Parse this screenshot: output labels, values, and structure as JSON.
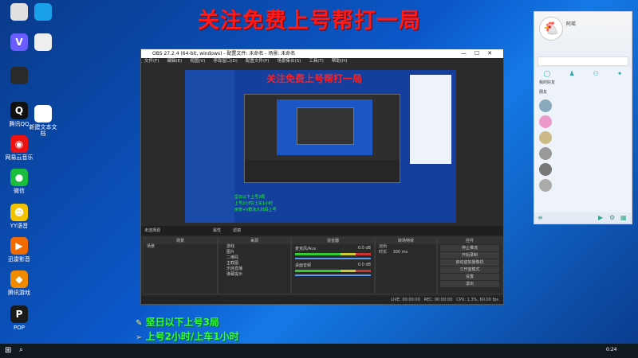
{
  "banner": "关注免费上号帮打一局",
  "desktop_icons": [
    {
      "label": "",
      "glyph": "",
      "color": "#e0e0e0"
    },
    {
      "label": "",
      "glyph": "",
      "color": "#1aa0e8"
    },
    {
      "label": "",
      "glyph": "V",
      "color": "#6a5cff"
    },
    {
      "label": "",
      "glyph": "",
      "color": "#eeeeee"
    },
    {
      "label": "",
      "glyph": "",
      "color": "#2a2a2a"
    },
    {
      "label": "腾讯QQ",
      "glyph": "Q",
      "color": "#111111"
    },
    {
      "label": "新建文本文档",
      "glyph": "",
      "color": "#ffffff"
    },
    {
      "label": "网易云音乐",
      "glyph": "◉",
      "color": "#e11"
    },
    {
      "label": "微信",
      "glyph": "●",
      "color": "#1bbe3a"
    },
    {
      "label": "YY语音",
      "glyph": "☻",
      "color": "#f2c200"
    },
    {
      "label": "迅雷影音",
      "glyph": "▶",
      "color": "#f06a00"
    },
    {
      "label": "腾讯游戏",
      "glyph": "◆",
      "color": "#f08a00"
    },
    {
      "label": "POP",
      "glyph": "P",
      "color": "#1a1a1a"
    }
  ],
  "obs": {
    "title": "OBS 27.2.4 (64-bit, windows) - 配置文件: 未命名 - 场景: 未命名",
    "menu": [
      "文件(F)",
      "编辑(E)",
      "视图(V)",
      "停靠窗口(D)",
      "配置文件(P)",
      "场景集合(S)",
      "工具(T)",
      "帮助(H)"
    ],
    "preview_banner": "关注免费上号帮打一局",
    "no_source": "未选择源",
    "props": "属性",
    "filters": "滤镜",
    "docks": {
      "scenes": {
        "title": "场景",
        "items": [
          "场景"
        ]
      },
      "sources": {
        "title": "来源",
        "items": [
          "游戏",
          "图片",
          "二维码",
          "主截图",
          "乐娃直播",
          "弹幕提示"
        ]
      },
      "mixer": {
        "title": "混音器",
        "channels": [
          {
            "name": "麦克风/Aux",
            "db": "0.0 dB"
          },
          {
            "name": "桌面音频",
            "db": "0.0 dB"
          }
        ]
      },
      "transitions": {
        "title": "转场特效",
        "type": "淡出",
        "duration_label": "时长",
        "duration": "300 ms"
      },
      "controls": {
        "title": "控件",
        "buttons": [
          "停止推流",
          "开始录制",
          "启动虚拟摄像机",
          "工作室模式",
          "设置",
          "退出"
        ]
      }
    },
    "status": {
      "live_label": "LIVE:",
      "live_time": "00:00:00",
      "rec_label": "REC:",
      "rec_time": "00:00:00",
      "cpu": "CPU: 1.3%, 60.00 fps"
    }
  },
  "qq": {
    "username": "阿瑶",
    "status": "",
    "search": "",
    "groups": [
      "我的好友",
      "朋友"
    ],
    "contacts": [
      "",
      "",
      "",
      "",
      "",
      ""
    ]
  },
  "overlay": {
    "line1": "坚日以下上号3局",
    "line2": "上号2小时/上车1小时",
    "line3": "房管+V群永久扫码上号"
  },
  "taskbar": {
    "time": "0:24"
  }
}
